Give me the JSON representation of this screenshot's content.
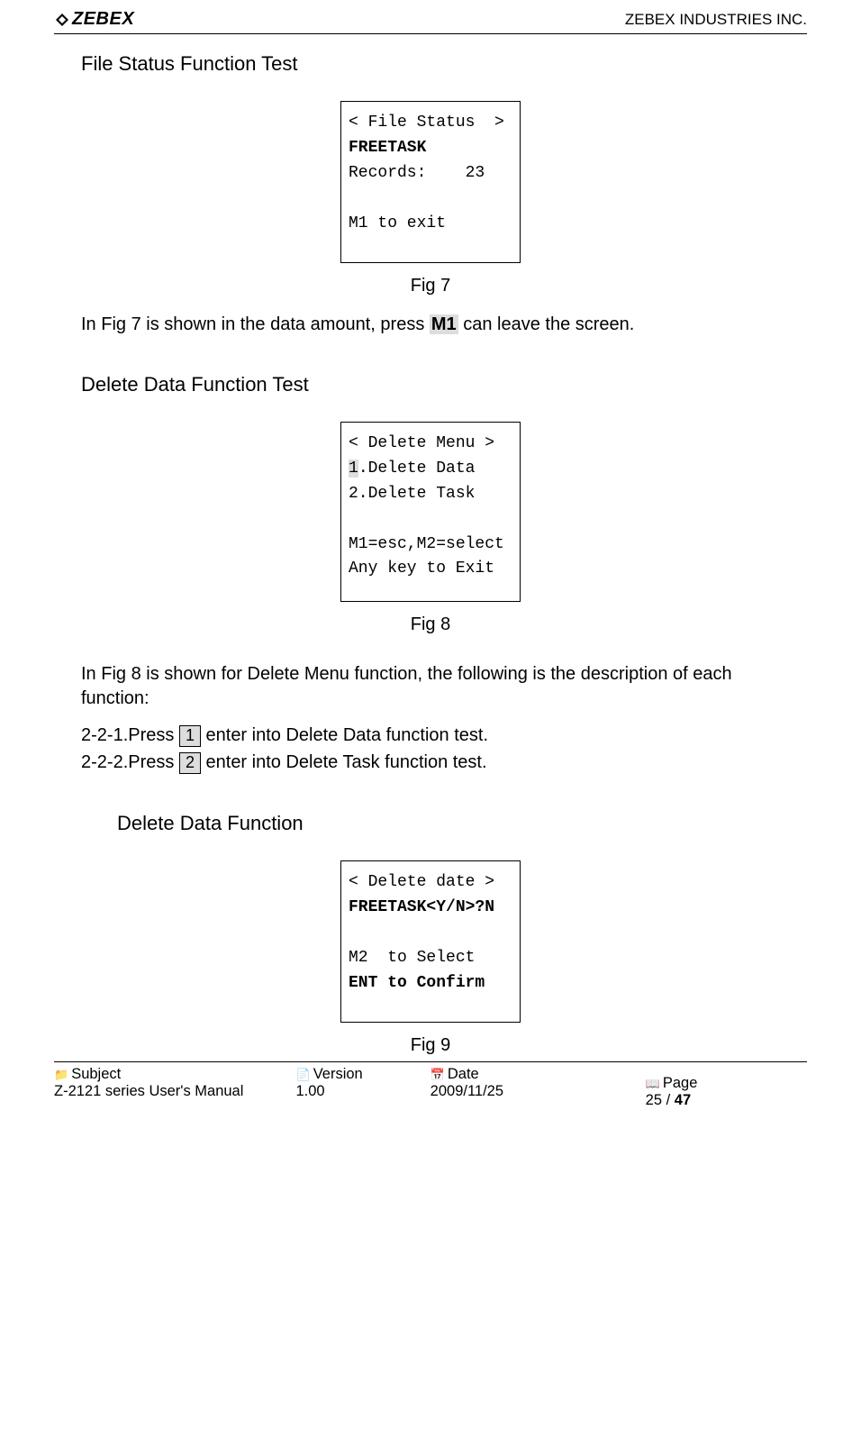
{
  "header": {
    "logo_text": "ZEBEX",
    "company": "ZEBEX INDUSTRIES INC."
  },
  "sections": {
    "file_status_title": "File Status Function Test",
    "delete_data_test_title": "Delete Data Function Test",
    "delete_data_func_title": "Delete Data Function"
  },
  "lcd7": {
    "l1": "< File Status  >",
    "l2": "FREETASK",
    "l3": "Records:    23",
    "l4": "",
    "l5": "M1 to exit"
  },
  "fig7_label": "Fig 7",
  "fig7_desc_a": "In Fig 7 is shown in the data amount, press ",
  "fig7_key": "M1",
  "fig7_desc_b": " can leave the screen.",
  "lcd8": {
    "l1": "< Delete Menu >",
    "l2a": "1",
    "l2b": ".Delete Data",
    "l3": "2.Delete Task",
    "l4": "",
    "l5": "M1=esc,M2=select",
    "l6": "Any key to Exit"
  },
  "fig8_label": "Fig 8",
  "fig8_desc": "In Fig 8 is shown for Delete Menu function, the following is the description of each function:",
  "steps": {
    "s1_prefix": "2-2-1.Press ",
    "s1_key": "1",
    "s1_suffix": "  enter into Delete Data function test.",
    "s2_prefix": "2-2-2.Press ",
    "s2_key": "2",
    "s2_suffix": "  enter into Delete Task function test."
  },
  "lcd9": {
    "l1": "< Delete date >",
    "l2": "FREETASK<Y/N>?N",
    "l3": "",
    "l4": "M2  to Select",
    "l5": "ENT to Confirm"
  },
  "fig9_label": "Fig 9",
  "footer": {
    "subject_label": "Subject",
    "subject_value": "Z-2121 series User's Manual",
    "version_label": "Version",
    "version_value": "1.00",
    "date_label": "Date",
    "date_value": "2009/11/25",
    "page_label": "Page",
    "page_current": "25",
    "page_sep": " / ",
    "page_total": "47"
  }
}
